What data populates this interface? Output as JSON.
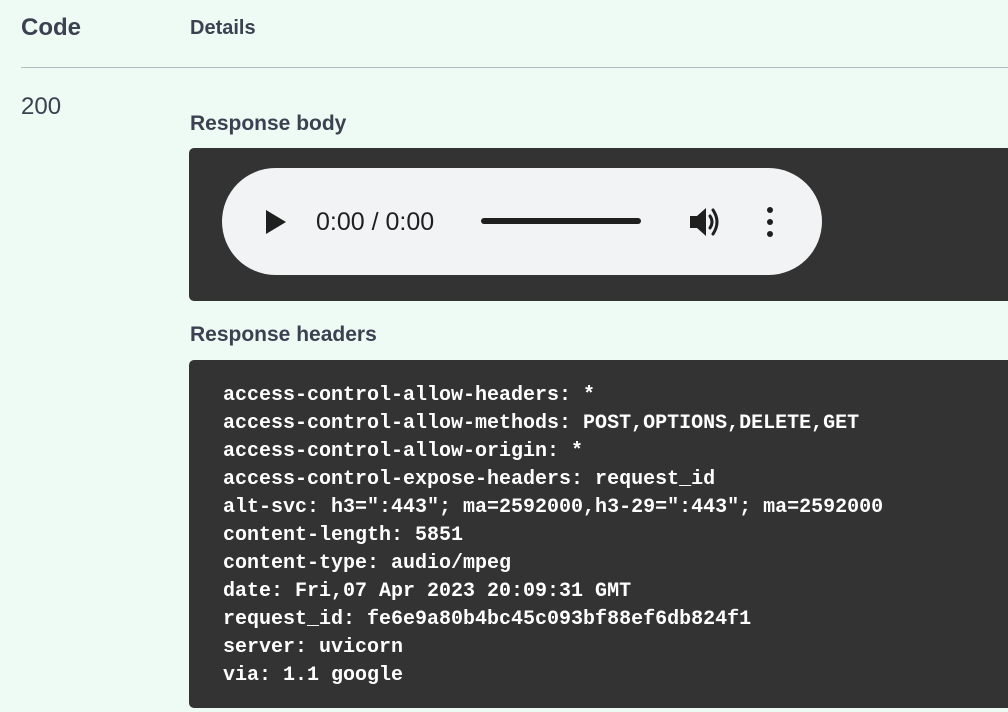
{
  "table": {
    "code_header": "Code",
    "details_header": "Details"
  },
  "response": {
    "status_code": "200",
    "body_label": "Response body",
    "headers_label": "Response headers",
    "audio": {
      "time_display": "0:00 / 0:00",
      "progress_fraction": 0
    },
    "headers": [
      "access-control-allow-headers: *",
      "access-control-allow-methods: POST,OPTIONS,DELETE,GET",
      "access-control-allow-origin: *",
      "access-control-expose-headers: request_id",
      "alt-svc: h3=\":443\"; ma=2592000,h3-29=\":443\"; ma=2592000",
      "content-length: 5851",
      "content-type: audio/mpeg",
      "date: Fri,07 Apr 2023 20:09:31 GMT",
      "request_id: fe6e9a80b4bc45c093bf88ef6db824f1",
      "server: uvicorn",
      "via: 1.1 google"
    ]
  },
  "icons": {
    "play": "play-icon",
    "volume": "volume-icon",
    "more": "more-vertical-icon"
  },
  "colors": {
    "background": "#eefaf4",
    "code_block": "#333333",
    "player_background": "#f1f3f4",
    "text": "#3b4151"
  }
}
